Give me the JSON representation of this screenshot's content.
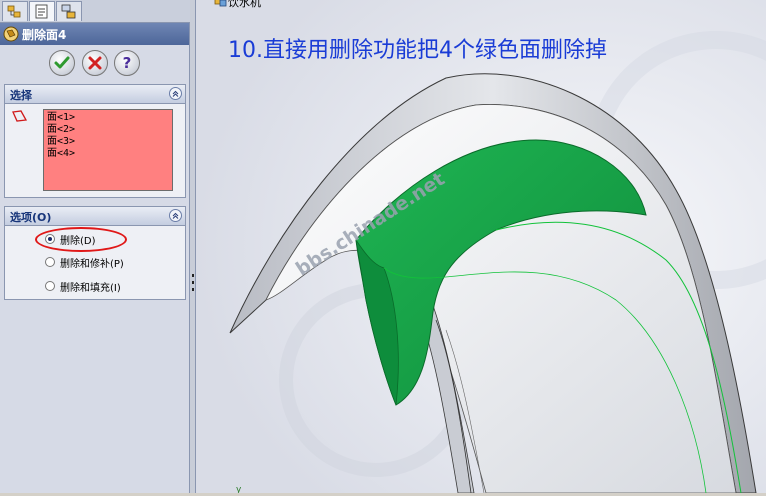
{
  "feature_manager": {
    "tabs": [
      {
        "icon": "feature-tree-icon"
      },
      {
        "icon": "property-manager-icon"
      },
      {
        "icon": "configuration-manager-icon"
      }
    ],
    "title": "删除面4",
    "title_icon": "delete-face-icon",
    "actions": [
      {
        "icon": "ok-check-icon",
        "color": "#2f9a2f"
      },
      {
        "icon": "cancel-x-icon",
        "color": "#d22222"
      },
      {
        "icon": "help-question-icon",
        "color": "#4b2e9b"
      }
    ]
  },
  "selection_group": {
    "title": "选择",
    "items": [
      "面<1>",
      "面<2>",
      "面<3>",
      "面<4>"
    ],
    "list_color": "#ff8080"
  },
  "options_group": {
    "title": "选项(O)",
    "options": [
      {
        "label": "删除(D)",
        "selected": true
      },
      {
        "label": "删除和修补(P)",
        "selected": false
      },
      {
        "label": "删除和填充(I)",
        "selected": false
      }
    ],
    "highlight_color": "#e01818"
  },
  "viewport": {
    "tree_label": "饮水机",
    "caption": "10.直接用删除功能把4个绿色面删除掉",
    "caption_color": "#1a3cd6",
    "watermark": "bbs.chinade.net",
    "selected_face_color": "#17a84a"
  }
}
